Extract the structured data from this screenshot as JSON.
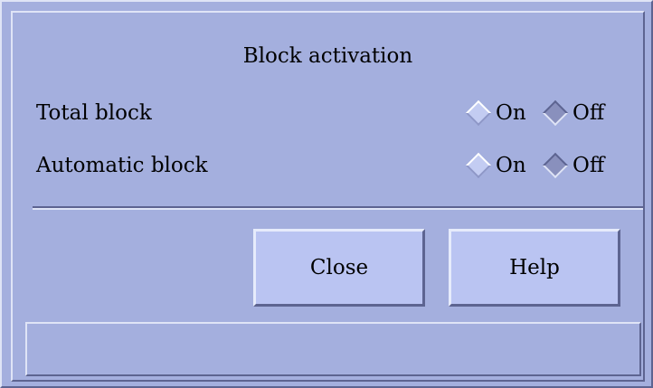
{
  "dialog": {
    "title": "Block activation"
  },
  "rows": [
    {
      "label": "Total block",
      "on_label": "On",
      "off_label": "Off",
      "selected": "Off"
    },
    {
      "label": "Automatic block",
      "on_label": "On",
      "off_label": "Off",
      "selected": "Off"
    }
  ],
  "buttons": {
    "close_label": "Close",
    "help_label": "Help"
  },
  "status": {
    "text": ""
  },
  "colors": {
    "background": "#a4afde",
    "button_face": "#bac4f2",
    "shadow": "#5d6491",
    "highlight": "#dfe4f6"
  }
}
